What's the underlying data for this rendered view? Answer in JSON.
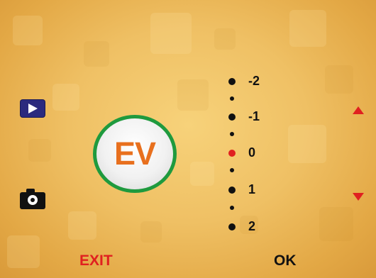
{
  "menu": {
    "badge": "EV",
    "selected_value": "0",
    "options": [
      "-2",
      "-1",
      "0",
      "1",
      "2"
    ]
  },
  "buttons": {
    "exit_label": "EXIT",
    "ok_label": "OK"
  },
  "icons": {
    "play": "play-icon",
    "camera": "camera-icon",
    "up": "arrow-up-icon",
    "down": "arrow-down-icon"
  },
  "colors": {
    "badge_ring": "#1f9a3e",
    "badge_text": "#e8701e",
    "accent_red": "#e02020",
    "play_button": "#2b2a7e"
  }
}
